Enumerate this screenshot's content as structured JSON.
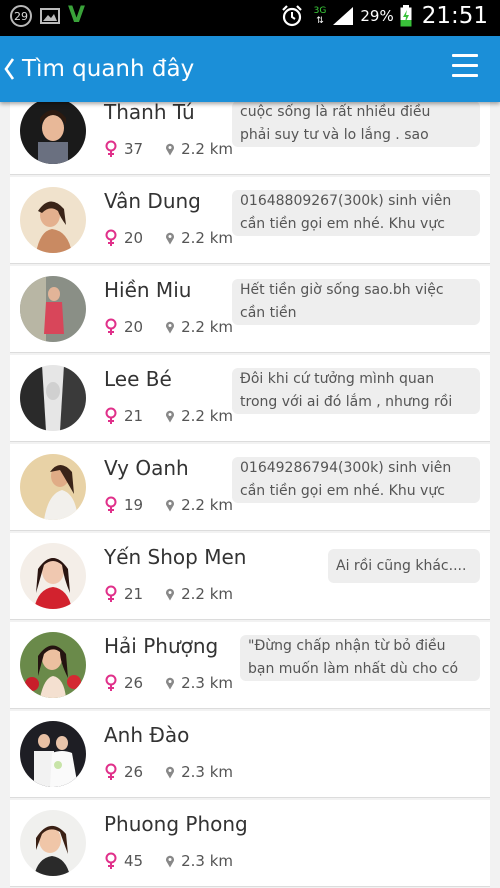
{
  "status_bar": {
    "notification_count": "29",
    "network": "3G",
    "battery": "29%",
    "time": "21:51"
  },
  "header": {
    "title": "Tìm quanh đây",
    "back_icon": "chevron-left-icon",
    "menu_icon": "hamburger-menu-icon"
  },
  "colors": {
    "app_bar": "#1b8fd8",
    "female_icon": "#e0308a"
  },
  "users": [
    {
      "name": "Thanh Tú",
      "age": "37",
      "distance": "2.2 km",
      "status_lines": [
        "cuộc sống là rất nhiều điều",
        "phải suy tư và lo lắng . sao"
      ]
    },
    {
      "name": "Vân Dung",
      "age": "20",
      "distance": "2.2 km",
      "status_lines": [
        "01648809267(300k) sinh viên",
        "cần tiền gọi em nhé. Khu vực"
      ]
    },
    {
      "name": "Hiền Miu",
      "age": "20",
      "distance": "2.2 km",
      "status_lines": [
        "Hết tiền giờ sống sao.bh việc",
        "cần tiền"
      ]
    },
    {
      "name": "Lee Bé",
      "age": "21",
      "distance": "2.2 km",
      "status_lines": [
        "Đôi khi cứ tưởng mình quan",
        "trong với ai đó lắm , nhưng rồi"
      ]
    },
    {
      "name": "Vy Oanh",
      "age": "19",
      "distance": "2.2 km",
      "status_lines": [
        "01649286794(300k) sinh viên",
        "cần tiền gọi em nhé. Khu vực"
      ]
    },
    {
      "name": "Yến Shop Men",
      "age": "21",
      "distance": "2.2 km",
      "status_lines": [
        "Ai rồi cũng khác...."
      ]
    },
    {
      "name": "Hải Phượng",
      "age": "26",
      "distance": "2.3 km",
      "status_lines": [
        "\"Đừng chấp nhận từ bỏ điều",
        "bạn muốn làm nhất dù cho có"
      ]
    },
    {
      "name": "Anh Đào",
      "age": "26",
      "distance": "2.3 km",
      "status_lines": []
    },
    {
      "name": "Phuong Phong",
      "age": "45",
      "distance": "2.3 km",
      "status_lines": []
    }
  ]
}
